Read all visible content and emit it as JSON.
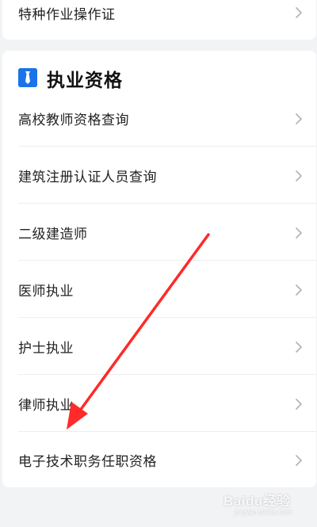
{
  "top_item": {
    "label": "特种作业操作证",
    "icon": "chevron-right-icon"
  },
  "section": {
    "title": "执业资格",
    "icon": "tie-icon",
    "icon_color": "#1a73e8",
    "items": [
      {
        "label": "高校教师资格查询"
      },
      {
        "label": "建筑注册认证人员查询"
      },
      {
        "label": "二级建造师"
      },
      {
        "label": "医师执业"
      },
      {
        "label": "护士执业"
      },
      {
        "label": "律师执业"
      },
      {
        "label": "电子技术职务任职资格"
      }
    ]
  },
  "annotation": {
    "arrow_color": "#ff2a2a"
  },
  "watermark": {
    "text": "Baidu经验",
    "subtext": "jingyan.baidu.com"
  }
}
